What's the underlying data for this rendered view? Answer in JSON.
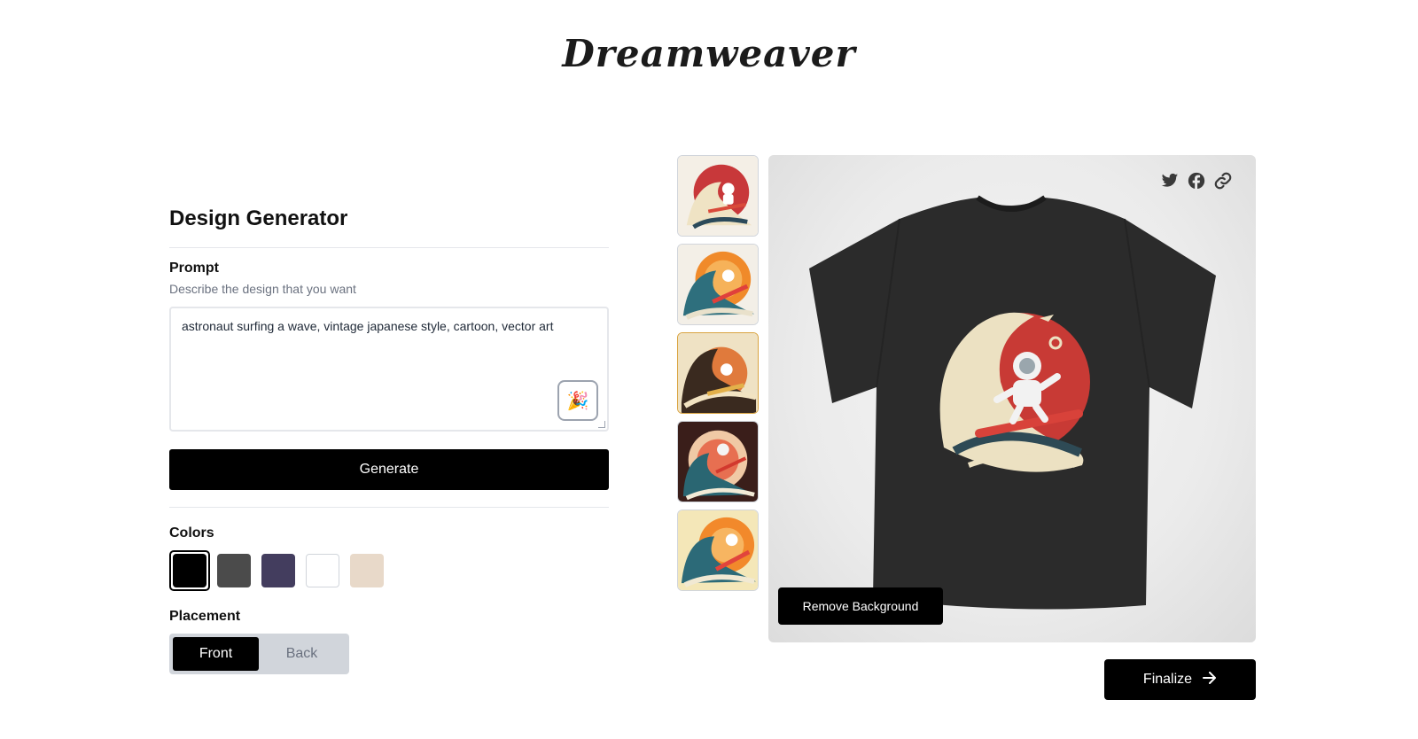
{
  "brand": {
    "logo_text": "Dreamweaver"
  },
  "generator": {
    "title": "Design Generator",
    "prompt_label": "Prompt",
    "prompt_help": "Describe the design that you want",
    "prompt_value": "astronaut surfing a wave, vintage japanese style, cartoon, vector art",
    "surprise_icon": "party-popper-icon",
    "generate_label": "Generate"
  },
  "colors": {
    "label": "Colors",
    "options": [
      {
        "name": "black",
        "hex": "#000000",
        "selected": true
      },
      {
        "name": "dark-grey",
        "hex": "#4b4b4b",
        "selected": false
      },
      {
        "name": "navy-purple",
        "hex": "#433d5e",
        "selected": false
      },
      {
        "name": "white",
        "hex": "#ffffff",
        "selected": false
      },
      {
        "name": "cream",
        "hex": "#e8d9c9",
        "selected": false
      }
    ]
  },
  "placement": {
    "label": "Placement",
    "options": [
      "Front",
      "Back"
    ],
    "selected": "Front"
  },
  "thumbnails": [
    {
      "name": "design-variant-1",
      "selected": false
    },
    {
      "name": "design-variant-2",
      "selected": false
    },
    {
      "name": "design-variant-3",
      "selected": true
    },
    {
      "name": "design-variant-4",
      "selected": false
    },
    {
      "name": "design-variant-5",
      "selected": false
    }
  ],
  "preview": {
    "share_icons": [
      "twitter-icon",
      "facebook-icon",
      "link-icon"
    ],
    "remove_background_label": "Remove Background"
  },
  "actions": {
    "finalize_label": "Finalize",
    "finalize_icon": "arrow-right-icon"
  },
  "theme": {
    "accent": "#000000",
    "border": "#e5e7eb",
    "muted": "#6b7280"
  }
}
